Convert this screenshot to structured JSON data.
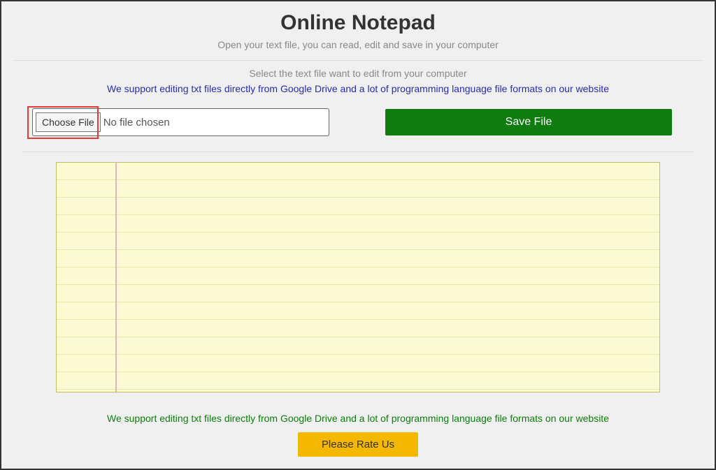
{
  "header": {
    "title": "Online Notepad",
    "subtitle": "Open your text file, you can read, edit and save in your computer"
  },
  "intro": {
    "select_text": "Select the text file want to edit from your computer",
    "support_link": "We support editing txt files directly from Google Drive and a lot of programming language file formats on our website"
  },
  "file": {
    "choose_label": "Choose File",
    "status_text": "No file chosen"
  },
  "actions": {
    "save_label": "Save File"
  },
  "editor": {
    "content": ""
  },
  "footer": {
    "support_link": "We support editing txt files directly from Google Drive and a lot of programming language file formats on our website",
    "rate_label": "Please Rate Us"
  }
}
